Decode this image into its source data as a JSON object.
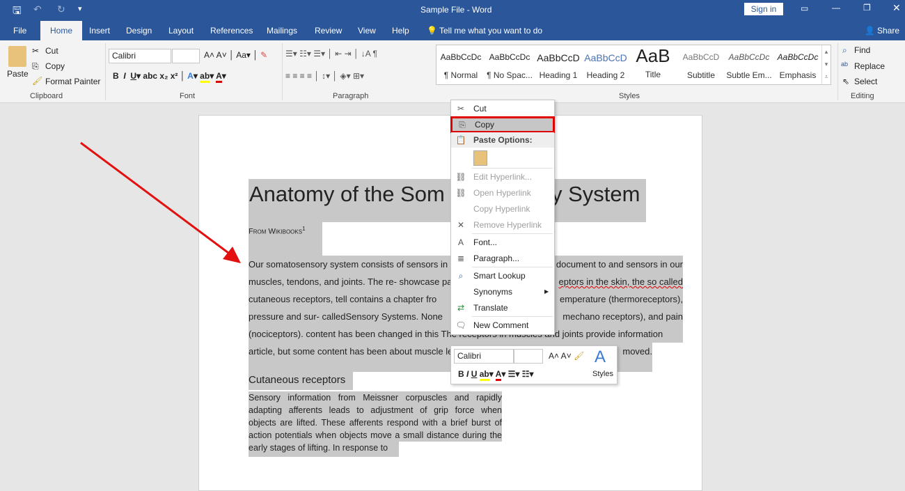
{
  "window": {
    "title": "Sample File - Word",
    "sign_in": "Sign in"
  },
  "tabs": [
    "File",
    "Home",
    "Insert",
    "Design",
    "Layout",
    "References",
    "Mailings",
    "Review",
    "View",
    "Help"
  ],
  "tell_me": "Tell me what you want to do",
  "share": "Share",
  "clipboard": {
    "paste": "Paste",
    "cut": "Cut",
    "copy": "Copy",
    "format_painter": "Format Painter",
    "group": "Clipboard"
  },
  "font": {
    "name": "Calibri",
    "size": "",
    "group": "Font"
  },
  "paragraph": {
    "group": "Paragraph"
  },
  "styles": {
    "group": "Styles",
    "items": [
      {
        "sample": "AaBbCcDc",
        "label": "¶ Normal"
      },
      {
        "sample": "AaBbCcDc",
        "label": "¶ No Spac..."
      },
      {
        "sample": "AaBbCcD",
        "label": "Heading 1"
      },
      {
        "sample": "AaBbCcD",
        "label": "Heading 2"
      },
      {
        "sample": "AaB",
        "label": "Title"
      },
      {
        "sample": "AaBbCcD",
        "label": "Subtitle"
      },
      {
        "sample": "AaBbCcDc",
        "label": "Subtle Em..."
      },
      {
        "sample": "AaBbCcDc",
        "label": "Emphasis"
      }
    ]
  },
  "editing": {
    "find": "Find",
    "replace": "Replace",
    "select": "Select",
    "group": "Editing"
  },
  "doc": {
    "title_left": "Anatomy of the Som",
    "title_right": "y System",
    "from": "From Wikibooks",
    "sup": "1",
    "lines": [
      [
        "Our somatosensory system consists of sensors in",
        "document to and sensors in our"
      ],
      [
        "muscles, tendons, and joints. The re- showcase pa",
        "eptors in the skin, the so called"
      ],
      [
        "cutaneous receptors, tell contains a chapter fro",
        "emperature (thermoreceptors),"
      ],
      [
        "pressure and sur- calledSensory Systems. None",
        "mechano receptors), and pain"
      ],
      [
        "(nociceptors). content has been changed in this The receptors in muscles and joints provide information",
        ""
      ],
      [
        "article, but some content has been about muscle le",
        "moved."
      ]
    ],
    "heading": "Cutaneous receptors",
    "para2": [
      "Sensory information from Meissner corpuscles and rapidly",
      "adapting afferents leads to adjustment of grip force when",
      "objects are lifted. These afferents respond with a brief burst of",
      "action potentials when objects move a small distance during the",
      "early stages of lifting. In response to"
    ]
  },
  "context_menu": {
    "items": [
      "Cut",
      "Copy",
      "Paste Options:",
      "Edit Hyperlink...",
      "Open Hyperlink",
      "Copy Hyperlink",
      "Remove Hyperlink",
      "Font...",
      "Paragraph...",
      "Smart Lookup",
      "Synonyms",
      "Translate",
      "New Comment"
    ],
    "highlighted": "Copy"
  },
  "mini_toolbar": {
    "font": "Calibri",
    "size": "",
    "styles": "Styles"
  },
  "colors": {
    "brand": "#2b579a",
    "highlight_border": "#e00000",
    "arrow": "#e31010"
  }
}
